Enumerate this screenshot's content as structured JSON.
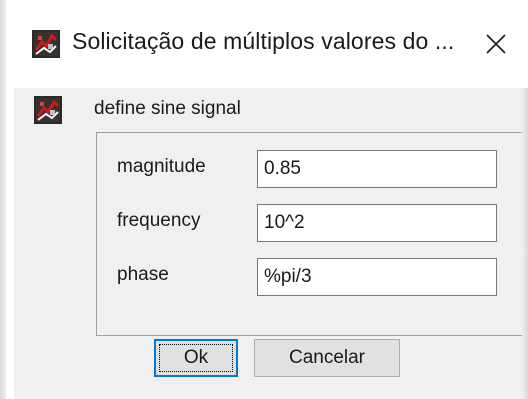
{
  "window": {
    "title": "Solicitação de múltiplos valores do ...",
    "icon": "scilab-app-icon"
  },
  "header": {
    "label": "define sine signal",
    "icon": "scilab-app-icon"
  },
  "fields": [
    {
      "label": "magnitude",
      "value": "0.85"
    },
    {
      "label": "frequency",
      "value": "10^2"
    },
    {
      "label": "phase",
      "value": "%pi/3"
    }
  ],
  "buttons": {
    "ok_label": "Ok",
    "cancel_label": "Cancelar"
  },
  "colors": {
    "accent": "#0078d7",
    "dialog_bg": "#f0f0f0",
    "icon_red": "#d01818"
  }
}
